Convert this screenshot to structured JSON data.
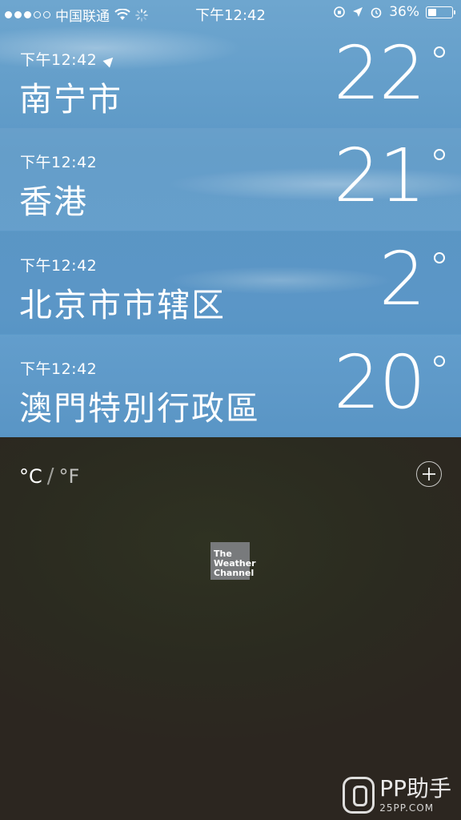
{
  "status_bar": {
    "carrier": "中国联通",
    "signal_bars": 3,
    "time": "下午12:42",
    "battery": "36%",
    "battery_level": 0.36
  },
  "cities": [
    {
      "time": "下午12:42",
      "name": "南宁市",
      "temp": "22",
      "current_location": true
    },
    {
      "time": "下午12:42",
      "name": "香港",
      "temp": "21",
      "current_location": false
    },
    {
      "time": "下午12:42",
      "name": "北京市市辖区",
      "temp": "2",
      "current_location": false
    },
    {
      "time": "下午12:42",
      "name": "澳門特別行政區",
      "temp": "20",
      "current_location": false
    }
  ],
  "footer": {
    "celsius": "°C",
    "separator": "/",
    "fahrenheit": "°F",
    "weather_channel_logo": "The Weather Channel"
  },
  "watermark": {
    "brand": "PP助手",
    "url": "25PP.COM"
  },
  "colors": {
    "sky": "#5c98c6",
    "footer_bg": "#2c2a22",
    "logo_bg": "#787a7c"
  }
}
